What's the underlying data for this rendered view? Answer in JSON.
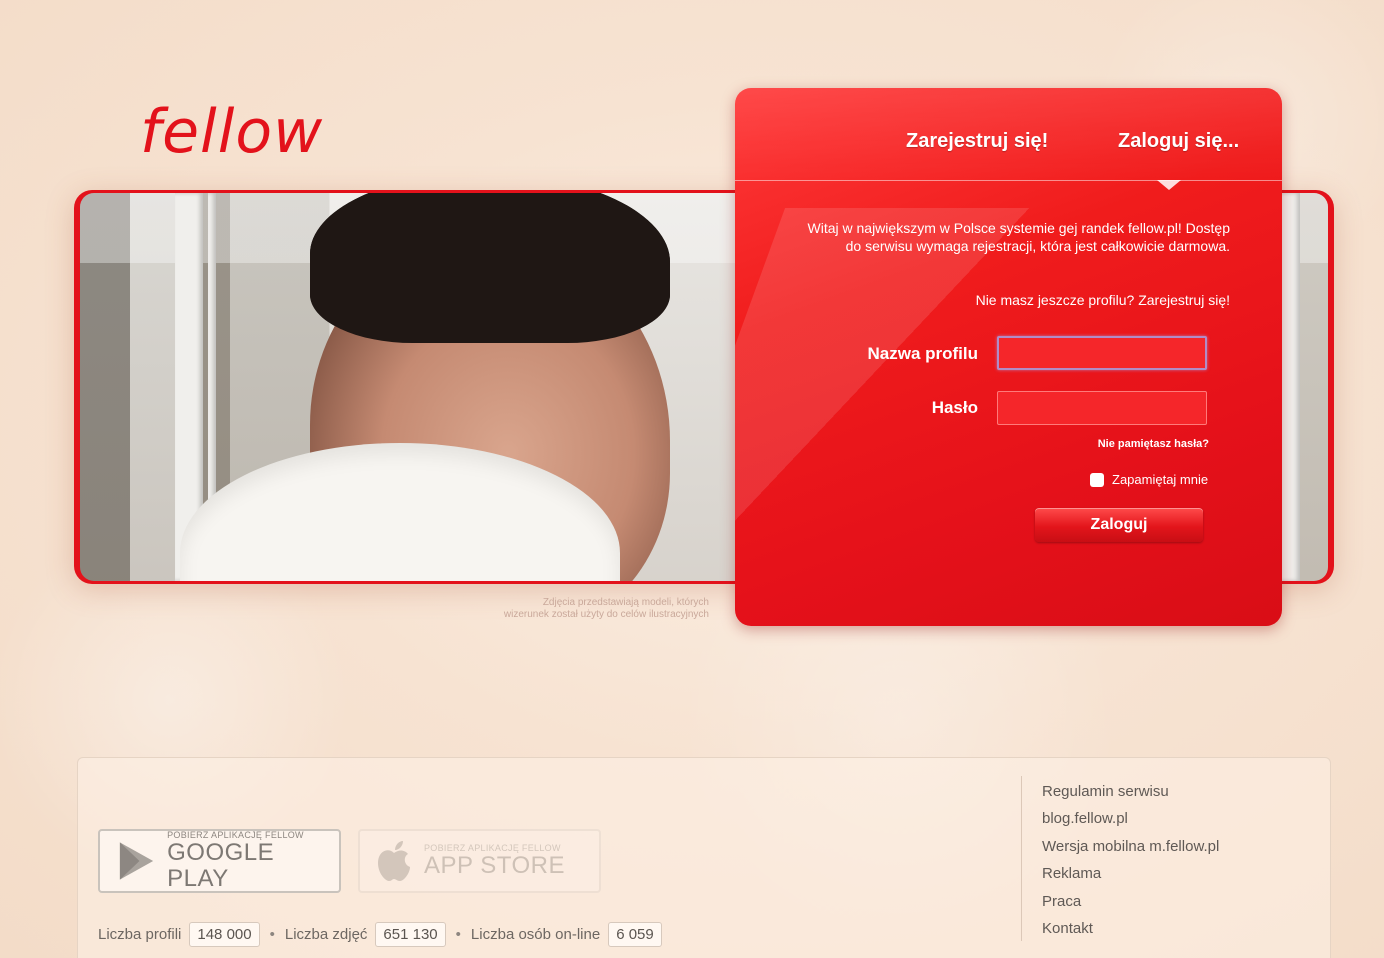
{
  "brand": {
    "logo_text": "fellow",
    "accent_color": "#e3121b"
  },
  "hero": {
    "caption_line1": "Zdjęcia przedstawiają modeli, których",
    "caption_line2": "wizerunek został użyty do celów ilustracyjnych"
  },
  "panel": {
    "tab_register": "Zarejestruj się!",
    "tab_login": "Zaloguj się...",
    "welcome": "Witaj w największym w Polsce systemie gej randek fellow.pl! Dostęp do serwisu wymaga rejestracji, która jest całkowicie darmowa.",
    "no_profile": "Nie masz jeszcze profilu? Zarejestruj się!",
    "username_label": "Nazwa profilu",
    "username_value": "",
    "password_label": "Hasło",
    "password_value": "",
    "forgot": "Nie pamiętasz hasła?",
    "remember": "Zapamiętaj mnie",
    "login_button": "Zaloguj"
  },
  "footer": {
    "google_small": "POBIERZ APLIKACJĘ FELLOW",
    "google_big": "GOOGLE PLAY",
    "apple_small": "POBIERZ APLIKACJĘ FELLOW",
    "apple_big": "APP STORE",
    "stats": {
      "profiles_label": "Liczba profili",
      "profiles_value": "148 000",
      "photos_label": "Liczba zdjęć",
      "photos_value": "651 130",
      "online_label": "Liczba osób on-line",
      "online_value": "6 059"
    },
    "links": [
      "Regulamin serwisu",
      "blog.fellow.pl",
      "Wersja mobilna m.fellow.pl",
      "Reklama",
      "Praca",
      "Kontakt"
    ]
  }
}
